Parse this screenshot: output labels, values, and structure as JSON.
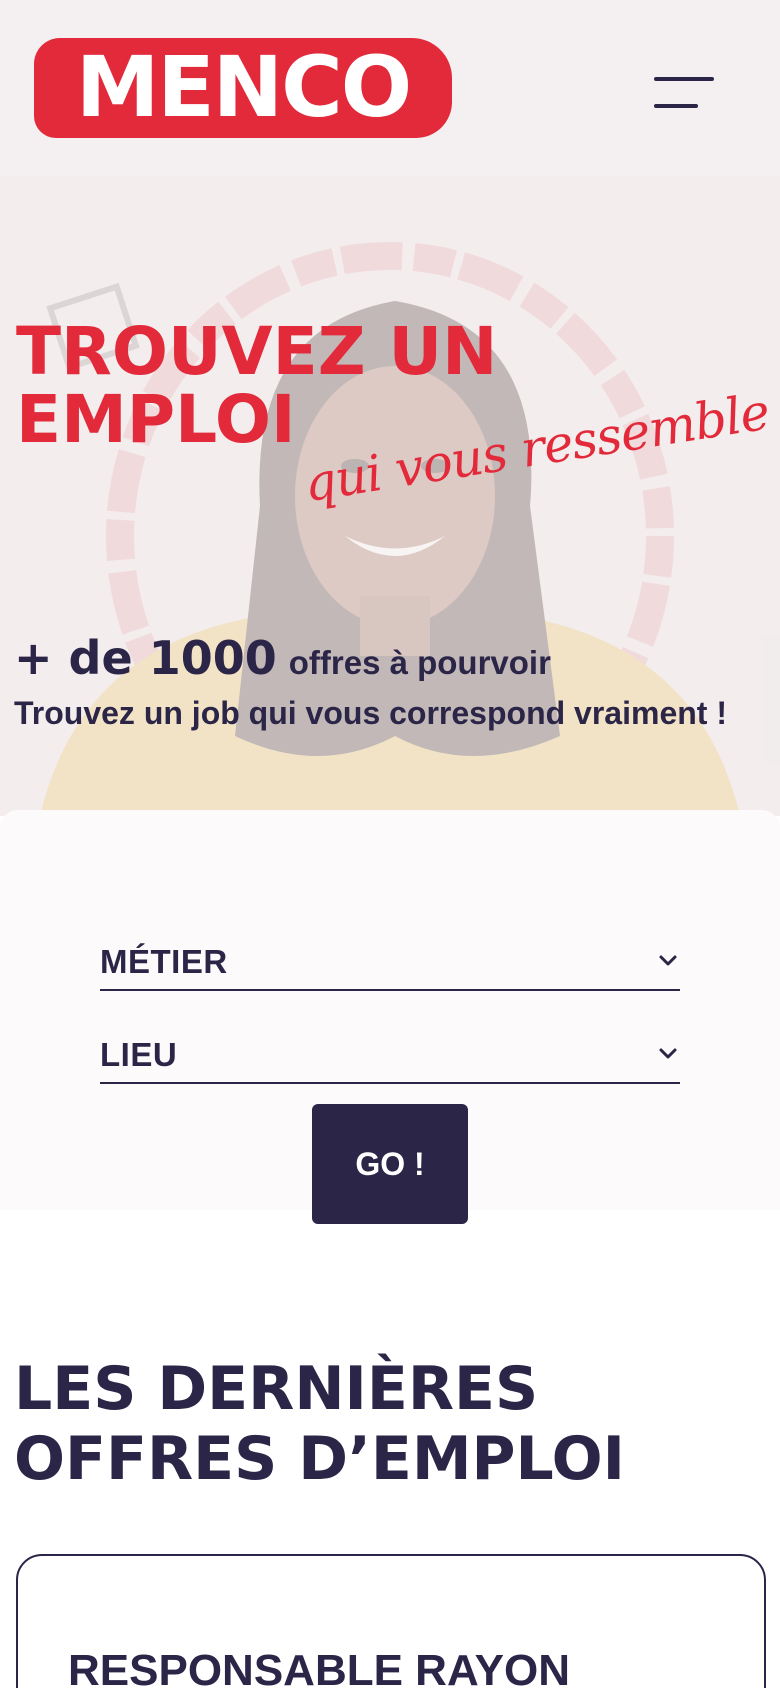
{
  "brand": {
    "logo_text": "MENCO",
    "accent": "#e22a3b",
    "ink": "#2b2547"
  },
  "header": {
    "menu_icon": "hamburger-menu-icon"
  },
  "hero": {
    "title_line1": "TROUVEZ UN",
    "title_line2": "EMPLOI",
    "script": "qui vous ressemble !",
    "count_big": "+ de 1000",
    "count_small": "offres à pourvoir",
    "subtitle": "Trouvez un job qui vous correspond vraiment !"
  },
  "search": {
    "metier_label": "MÉTIER",
    "lieu_label": "LIEU",
    "go_label": "GO !",
    "chevron_icon": "chevron-down-icon"
  },
  "offers": {
    "title_line1": "LES DERNIÈRES",
    "title_line2": "OFFRES D’EMPLOI",
    "items": [
      {
        "title": "RESPONSABLE RAYON"
      }
    ]
  }
}
